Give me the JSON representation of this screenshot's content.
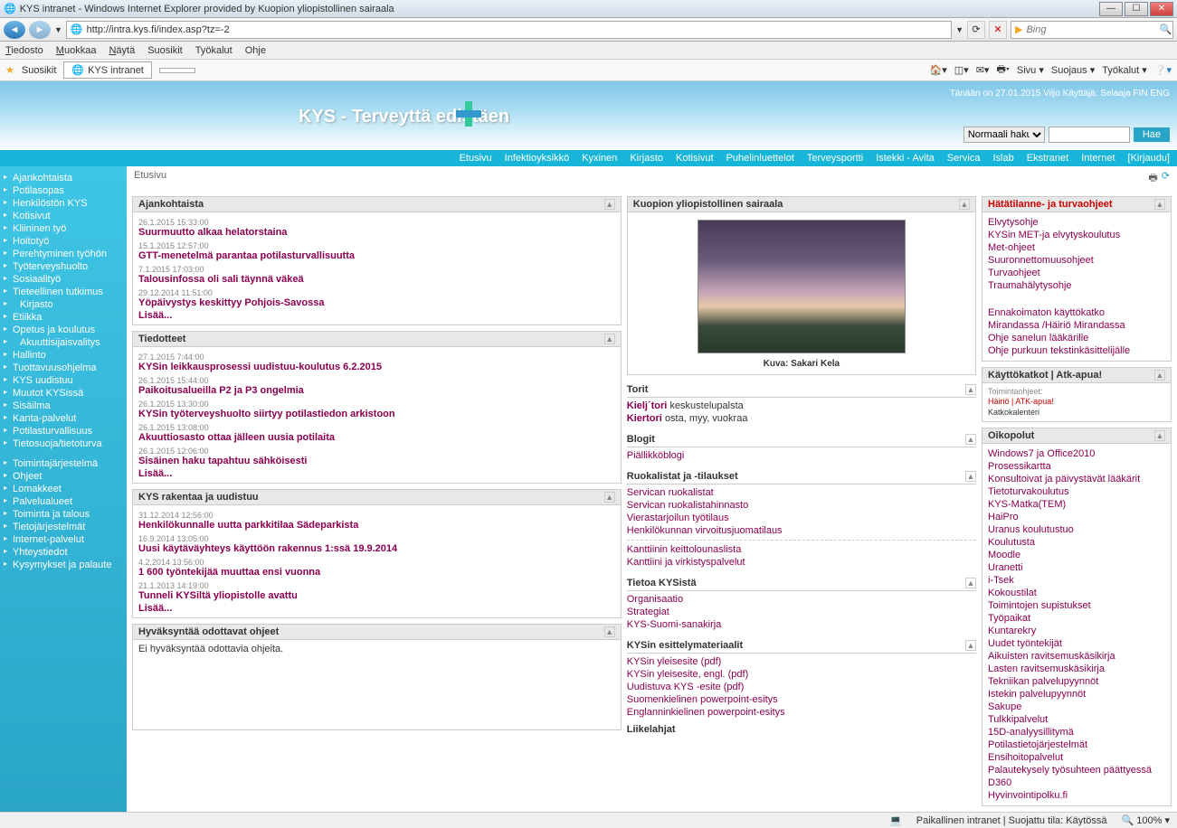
{
  "window": {
    "title": "KYS intranet - Windows Internet Explorer provided by Kuopion yliopistollinen sairaala",
    "min": "—",
    "max": "☐",
    "close": "✕"
  },
  "nav": {
    "url": "http://intra.kys.fi/index.asp?tz=-2",
    "refresh": "⟳",
    "stop": "✕",
    "search_placeholder": "Bing"
  },
  "menubar": {
    "tiedosto": "Tiedosto",
    "muokkaa": "Muokkaa",
    "nayta": "Näytä",
    "suosikit": "Suosikit",
    "tyokalut": "Työkalut",
    "ohje": "Ohje"
  },
  "favbar": {
    "favorites": "Suosikit",
    "tab": "KYS intranet",
    "toolbar": {
      "sivu": "Sivu ▾",
      "suojaus": "Suojaus ▾",
      "tyokalut": "Työkalut ▾"
    }
  },
  "banner": {
    "title": "KYS - Terveyttä edistäen",
    "status": "Tänään on 27.01.2015   Viljo   Käyttäjä: Selaaja   FIN ENG",
    "search_mode": "Normaali haku",
    "hae": "Hae"
  },
  "topnav": {
    "items": [
      "Etusivu",
      "Infektioyksikkö",
      "Kyxinen",
      "Kirjasto",
      "Kotisivut",
      "Puhelinluettelot",
      "Terveysportti",
      "Istekki - Avita",
      "Servica",
      "Islab",
      "Ekstranet",
      "Internet",
      "[Kirjaudu]"
    ]
  },
  "sidebar": {
    "items": [
      "Ajankohtaista",
      "Potilasopas",
      "Henkilöstön KYS",
      "Kotisivut",
      "Kliininen työ",
      "Hoitotyö",
      "Perehtyminen työhön",
      "Työterveyshuolto",
      "Sosiaalityö",
      "Tieteellinen tutkimus",
      "Kirjasto",
      "Etiikka",
      "Opetus ja koulutus",
      "Akuuttisijaisvalitys",
      "Hallinto",
      "Tuottavuusohjelma",
      "KYS uudistuu",
      "Muutot KYSissä",
      "Sisäilma",
      "Kanta-palvelut",
      "Potilasturvallisuus",
      "Tietosuoja/tietoturva"
    ],
    "items2": [
      "Toimintajärjestelmä",
      "Ohjeet",
      "Lomakkeet",
      "Palvelualueet",
      "Toiminta ja talous",
      "Tietojärjestelmät",
      "Internet-palvelut",
      "Yhteystiedot",
      "Kysymykset ja palaute"
    ]
  },
  "breadcrumb": "Etusivu",
  "ajankohtaista": {
    "header": "Ajankohtaista",
    "items": [
      {
        "date": "26.1.2015 15:33:00",
        "title": "Suurmuutto alkaa helatorstaina"
      },
      {
        "date": "15.1.2015 12:57:00",
        "title": "GTT-menetelmä parantaa potilasturvallisuutta"
      },
      {
        "date": "7.1.2015 17:03:00",
        "title": "Talousinfossa oli sali täynnä väkeä"
      },
      {
        "date": "29.12.2014 11:51:00",
        "title": "Yöpäivystys keskittyy Pohjois-Savossa"
      }
    ],
    "more": "Lisää..."
  },
  "tiedotteet": {
    "header": "Tiedotteet",
    "items": [
      {
        "date": "27.1.2015 7:44:00",
        "title": "KYSin leikkausprosessi uudistuu-koulutus 6.2.2015"
      },
      {
        "date": "26.1.2015 15:44:00",
        "title": "Paikoitusalueilla P2 ja P3 ongelmia"
      },
      {
        "date": "26.1.2015 13:30:00",
        "title": "KYSin työterveyshuolto siirtyy potilastiedon arkistoon"
      },
      {
        "date": "26.1.2015 13:08:00",
        "title": "Akuuttiosasto ottaa jälleen uusia potilaita"
      },
      {
        "date": "26.1.2015 12:06:00",
        "title": "Sisäinen haku tapahtuu sähköisesti"
      }
    ],
    "more": "Lisää..."
  },
  "rakentaa": {
    "header": "KYS rakentaa ja uudistuu",
    "items": [
      {
        "date": "31.12.2014 12:56:00",
        "title": "Henkilökunnalle uutta parkkitilaa Sädeparkista"
      },
      {
        "date": "16.9.2014 13:05:00",
        "title": "Uusi käytäväyhteys käyttöön rakennus 1:ssä 19.9.2014"
      },
      {
        "date": "4.2.2014 13:56:00",
        "title": "1 600 työntekijää muuttaa ensi vuonna"
      },
      {
        "date": "21.1.2013 14:19:00",
        "title": "Tunneli KYSiltä yliopistolle avattu"
      }
    ],
    "more": "Lisää..."
  },
  "hyvaksyntaa": {
    "header": "Hyväksyntää odottavat ohjeet",
    "text": "Ei hyväksyntää odottavia ohjeita."
  },
  "sairaala": {
    "header": "Kuopion yliopistollinen sairaala",
    "caption": "Kuva: Sakari Kela"
  },
  "torit": {
    "header": "Torit",
    "items": [
      {
        "label": "Kielj´tori",
        "suffix": "keskustelupalsta"
      },
      {
        "label": "Kiertori",
        "suffix": "osta, myy, vuokraa"
      }
    ]
  },
  "blogit": {
    "header": "Blogit",
    "item": "Piällikköblogi"
  },
  "ruokalistat": {
    "header": "Ruokalistat ja -tilaukset",
    "items": [
      "Servican ruokalistat",
      "Servican ruokalistahinnasto",
      "Vierastarjoilun työtilaus",
      "Henkilökunnan virvoitusjuomatilaus"
    ],
    "items2": [
      "Kanttiinin keittolounaslista",
      "Kanttiini ja virkistyspalvelut"
    ]
  },
  "tietoa": {
    "header": "Tietoa KYSistä",
    "items": [
      "Organisaatio",
      "Strategiat",
      "KYS-Suomi-sanakirja"
    ]
  },
  "esittely": {
    "header": "KYSin esittelymateriaalit",
    "items": [
      "KYSin yleisesite (pdf)",
      "KYSin yleisesite, engl. (pdf)",
      "Uudistuva KYS -esite (pdf)",
      "Suomenkielinen powerpoint-esitys",
      "Englanninkielinen powerpoint-esitys"
    ],
    "liikelahjat": "Liikelahjat"
  },
  "hatatilanne": {
    "header": "Hätätilanne- ja turvaohjeet",
    "items": [
      "Elvytysohje",
      "KYSin MET-ja elvytyskoulutus",
      "Met-ohjeet",
      "Suuronnettomuusohjeet",
      "Turvaohjeet",
      "Traumahälytysohje"
    ],
    "items2": [
      "Ennakoimaton käyttökatko",
      "Mirandassa /Häiriö Mirandassa",
      "Ohje sanelun lääkärille",
      "Ohje purkuun tekstinkäsittelijälle"
    ]
  },
  "kayttokatkot": {
    "header": "Käyttökatkot | Atk-apua!",
    "sub": "Toimintaohjeet:",
    "links": "Häiriö | ATK-apua!",
    "kal": "Katkokalenteri"
  },
  "oikopolut": {
    "header": "Oikopolut",
    "items": [
      "Windows7 ja Office2010",
      "Prosessikartta",
      "Konsultoivat ja päivystävät lääkärit",
      "Tietoturvakoulutus",
      "KYS-Matka(TEM)",
      "HaiPro",
      "Uranus koulutustuo",
      "Koulutusta",
      "Moodle",
      "Uranetti",
      "i-Tsek",
      "Kokoustilat",
      "Toimintojen supistukset",
      "Työpaikat",
      "Kuntarekry",
      "Uudet työntekijät",
      "Aikuisten ravitsemuskäsikirja",
      "Lasten ravitsemuskäsikirja",
      "Tekniikan palvelupyynnöt",
      "Istekin palvelupyynnöt",
      "Sakupe",
      "Tulkkipalvelut",
      "15D-analyysillitymä",
      "Potilastietojärjestelmät",
      "Ensihoitopalvelut",
      "Palautekysely työsuhteen päättyessä",
      "D360",
      "Hyvinvointipolku.fi"
    ]
  },
  "statusbar": {
    "zone": "Paikallinen intranet | Suojattu tila: Käytössä",
    "zoom": "100%"
  }
}
